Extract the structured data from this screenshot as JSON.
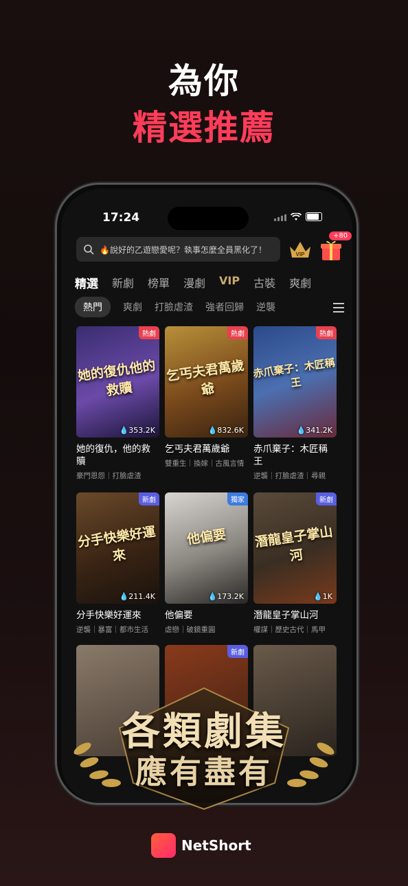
{
  "header": {
    "line1": "為你",
    "line2": "精選推薦"
  },
  "status": {
    "time": "17:24"
  },
  "search": {
    "text": "🔥說好的乙遊戀愛呢？執事怎麼全員黑化了！"
  },
  "gift_badge": "+80",
  "vip_label": "VIP",
  "tabs": [
    "精選",
    "新劇",
    "榜單",
    "漫劇",
    "VIP",
    "古裝",
    "爽劇"
  ],
  "chips": [
    "熱門",
    "爽劇",
    "打臉虐渣",
    "強者回歸",
    "逆襲"
  ],
  "cards": [
    {
      "title": "她的復仇，他的救贖",
      "tag": "熱劇",
      "tag_color": "#e8414f",
      "views": "353.2K",
      "tags": "豪門恩怨｜打臉虐渣",
      "poster_text": "她的復仇他的救贖"
    },
    {
      "title": "乞丐夫君萬歲爺",
      "tag": "熱劇",
      "tag_color": "#e8414f",
      "views": "832.6K",
      "tags": "雙重生｜換嫁｜古風言情",
      "poster_text": "乞丐夫君萬歲爺"
    },
    {
      "title": "赤爪棄子：木匠稱王",
      "tag": "熱劇",
      "tag_color": "#e8414f",
      "views": "341.2K",
      "tags": "逆襲｜打臉虐渣｜尋親",
      "poster_text": "赤爪棄子：木匠稱王"
    },
    {
      "title": "分手快樂好運來",
      "tag": "新劇",
      "tag_color": "#5a5ee0",
      "views": "211.4K",
      "tags": "逆襲｜暴富｜都市生活",
      "poster_text": "分手快樂好運來"
    },
    {
      "title": "他偏要",
      "tag": "獨家",
      "tag_color": "#3d7be0",
      "views": "173.2K",
      "tags": "虐戀｜破鏡重圓",
      "poster_text": "他偏要"
    },
    {
      "title": "潛龍皇子掌山河",
      "tag": "新劇",
      "tag_color": "#5a5ee0",
      "views": "1K",
      "tags": "權謀｜歷史古代｜馬甲",
      "poster_text": "潛龍皇子掌山河"
    }
  ],
  "bottom_row_tag": "新劇",
  "banner": {
    "line1": "各類劇集",
    "line2": "應有盡有"
  },
  "brand": {
    "name": "NetShort"
  }
}
